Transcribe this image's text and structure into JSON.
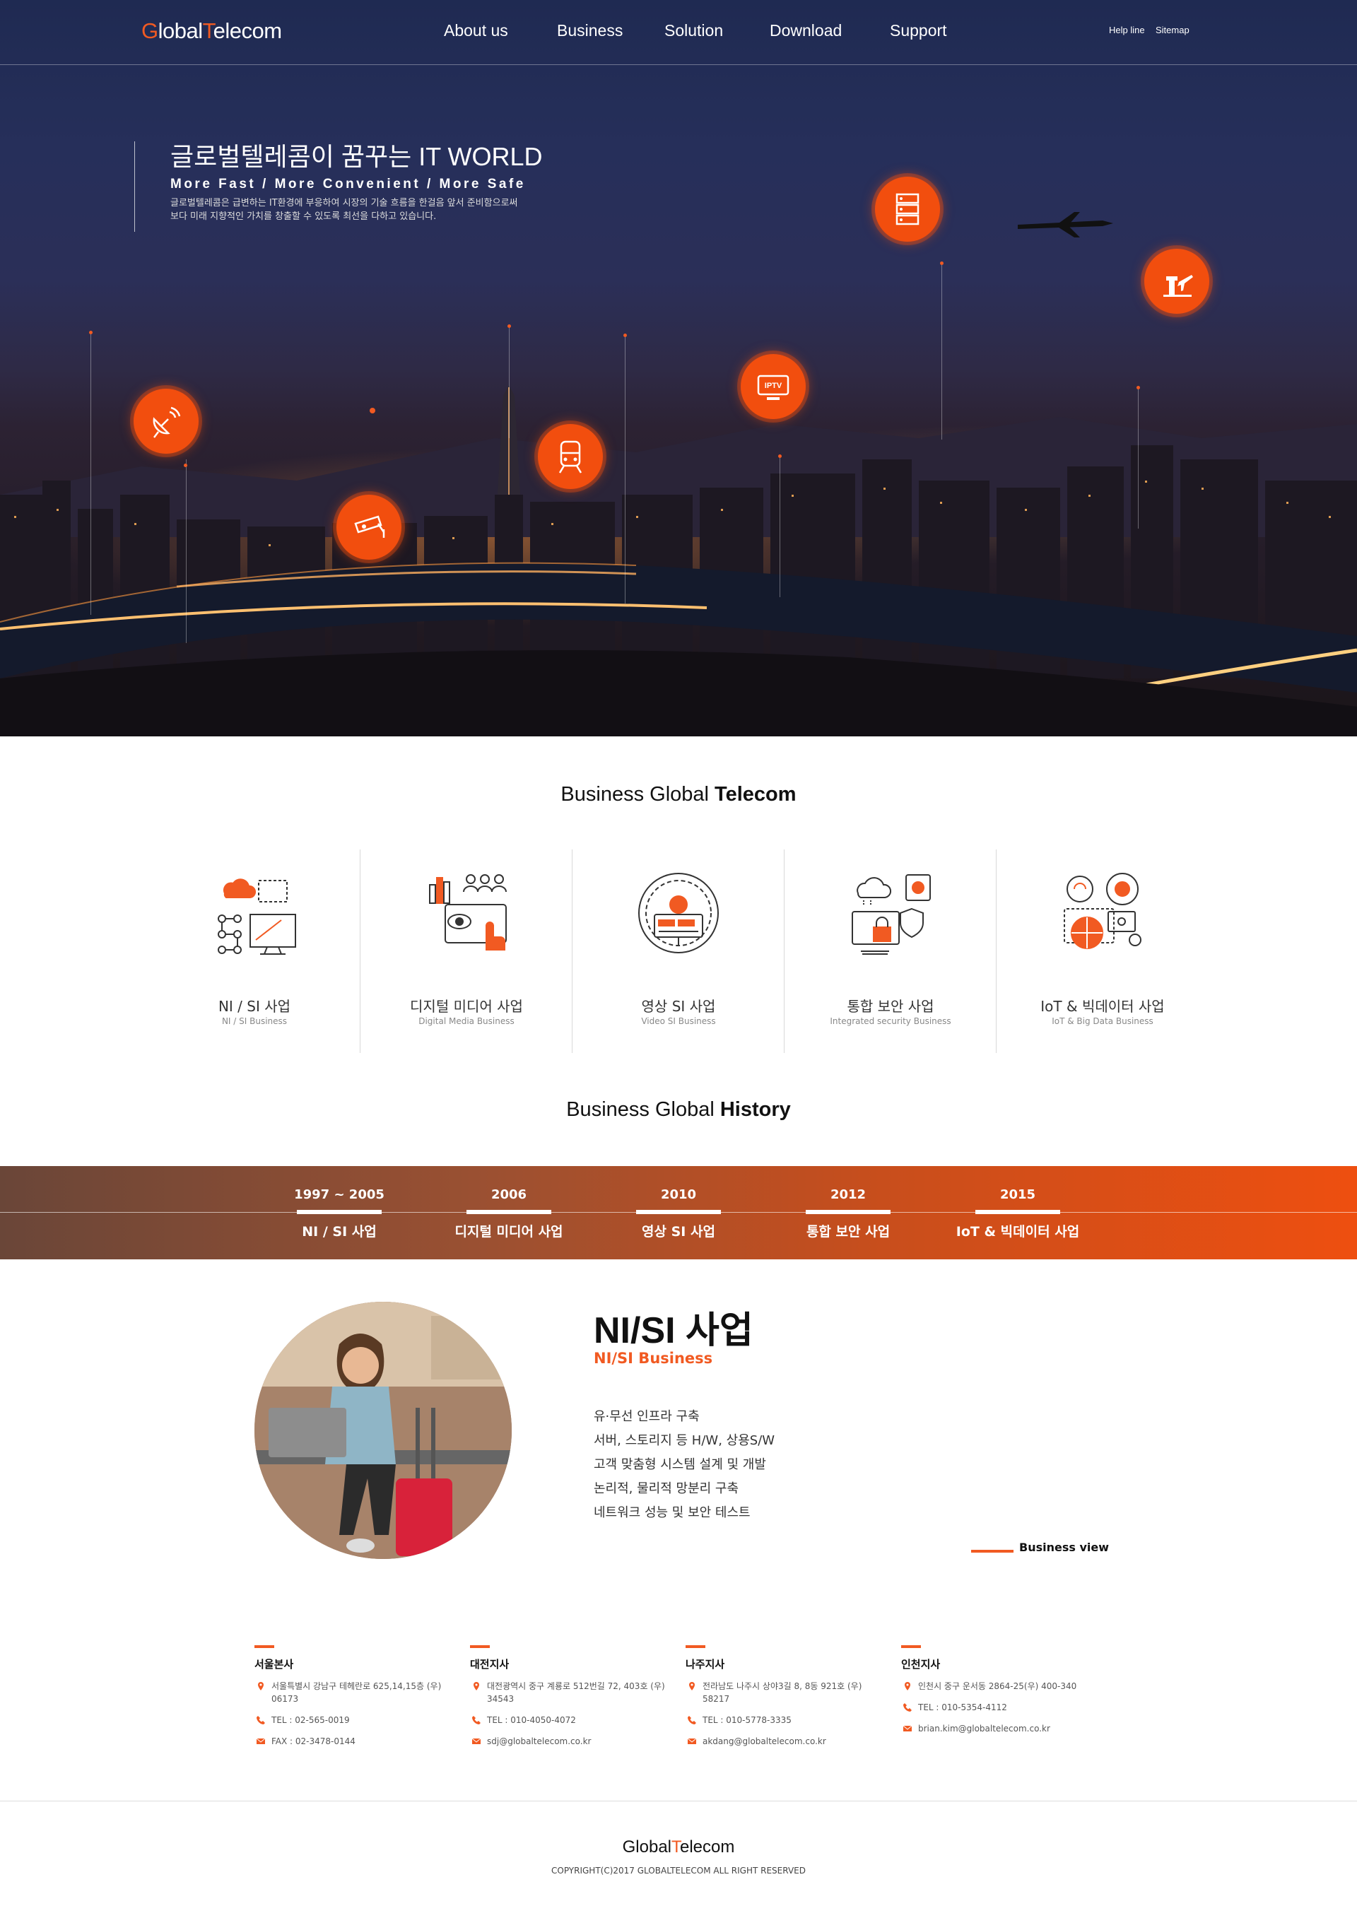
{
  "nav": {
    "logo_g": "G",
    "logo_lobal": "lobal",
    "logo_t": "T",
    "logo_elecom": "elecom",
    "links": [
      "About us",
      "Business",
      "Solution",
      "Download",
      "Support"
    ],
    "util": [
      "Help line",
      "Sitemap"
    ]
  },
  "hero": {
    "title": "글로벌텔레콤이 꿈꾸는 IT WORLD",
    "subtitle": "More Fast / More Convenient / More Safe",
    "desc_line1": "글로벌텔레콤은 급변하는 IT환경에 부응하여 시장의 기술 흐름을 한걸음 앞서 준비함으로써",
    "desc_line2": "보다 미래 지향적인 가치를 창출할 수 있도록 최선을 다하고 있습니다.",
    "iptv_label": "IPTV"
  },
  "business": {
    "title_plain": "Business Global ",
    "title_bold": "Telecom",
    "items": [
      {
        "ko": "NI / SI 사업",
        "en": "NI / SI Business"
      },
      {
        "ko": "디지털 미디어 사업",
        "en": "Digital Media Business"
      },
      {
        "ko": "영상 SI 사업",
        "en": "Video SI Business"
      },
      {
        "ko": "통합 보안 사업",
        "en": "Integrated security Business"
      },
      {
        "ko": "IoT & 빅데이터 사업",
        "en": "IoT & Big Data Business"
      }
    ]
  },
  "history": {
    "title_plain": "Business Global ",
    "title_bold": "History",
    "items": [
      {
        "year": "1997 ~ 2005",
        "name": "NI / SI 사업"
      },
      {
        "year": "2006",
        "name": "디지털 미디어 사업"
      },
      {
        "year": "2010",
        "name": "영상 SI 사업"
      },
      {
        "year": "2012",
        "name": "통합 보안 사업"
      },
      {
        "year": "2015",
        "name": "IoT & 빅데이터 사업"
      }
    ]
  },
  "detail": {
    "title": "NI/SI 사업",
    "subtitle": "NI/SI Business",
    "list": [
      "유·무선 인프라 구축",
      "서버, 스토리지 등 H/W, 상용S/W",
      "고객 맞춤형 시스템 설계 및 개발",
      "논리적, 물리적 망분리 구축",
      "네트워크 성능 및 보안 테스트"
    ],
    "view_label": "Business view"
  },
  "offices": [
    {
      "name": "서울본사",
      "addr": "서울특별시 강남구 테헤란로 625,14,15층 (우) 06173",
      "tel": "TEL : 02-565-0019",
      "extra": "FAX : 02-3478-0144"
    },
    {
      "name": "대전지사",
      "addr": "대전광역시 중구 계룡로 512번길 72, 403호 (우) 34543",
      "tel": "TEL : 010-4050-4072",
      "extra": "sdj@globaltelecom.co.kr"
    },
    {
      "name": "나주지사",
      "addr": "전라남도 나주시 상야3길 8, 8동 921호 (우) 58217",
      "tel": "TEL : 010-5778-3335",
      "extra": "akdang@globaltelecom.co.kr"
    },
    {
      "name": "인천지사",
      "addr": "인천시 중구 운서동 2864-25(우) 400-340",
      "tel": "TEL : 010-5354-4112",
      "extra": "brian.kim@globaltelecom.co.kr"
    }
  ],
  "footer": {
    "logo_a": "Global",
    "logo_t": "T",
    "logo_b": "elecom",
    "copyright": "COPYRIGHT(C)2017 GLOBALTELECOM ALL RIGHT RESERVED"
  },
  "colors": {
    "accent": "#f15a22",
    "navy": "#1f2a52"
  }
}
